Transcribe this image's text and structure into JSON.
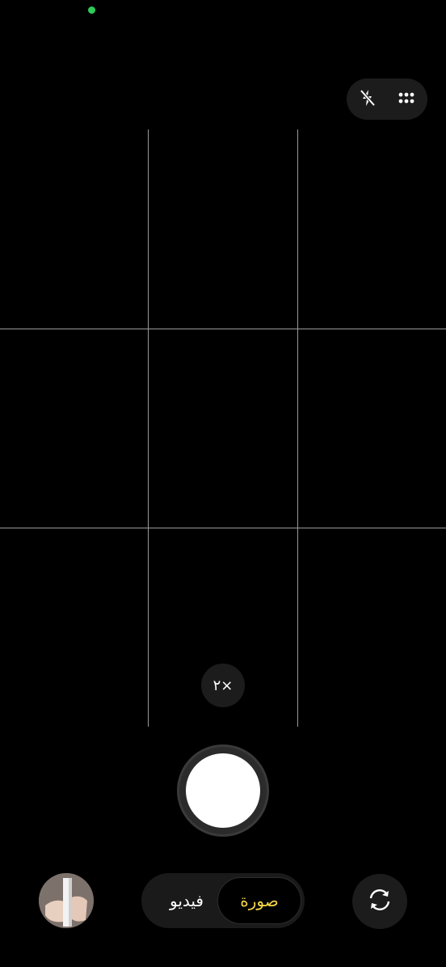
{
  "status": {
    "privacy_indicator_color": "#2ecc5a"
  },
  "top_controls": {
    "flash_icon": "flash-off-icon",
    "more_icon": "grid-dots-icon"
  },
  "viewfinder": {
    "grid": true
  },
  "zoom": {
    "label": "٢×"
  },
  "modes": {
    "items": [
      {
        "label": "فيديو",
        "active": false
      },
      {
        "label": "صورة",
        "active": true
      }
    ],
    "active_color": "#f5d547",
    "inactive_color": "#ffffff"
  },
  "bottom_controls": {
    "gallery_icon": "gallery-thumbnail",
    "switch_camera_icon": "camera-switch-icon"
  }
}
